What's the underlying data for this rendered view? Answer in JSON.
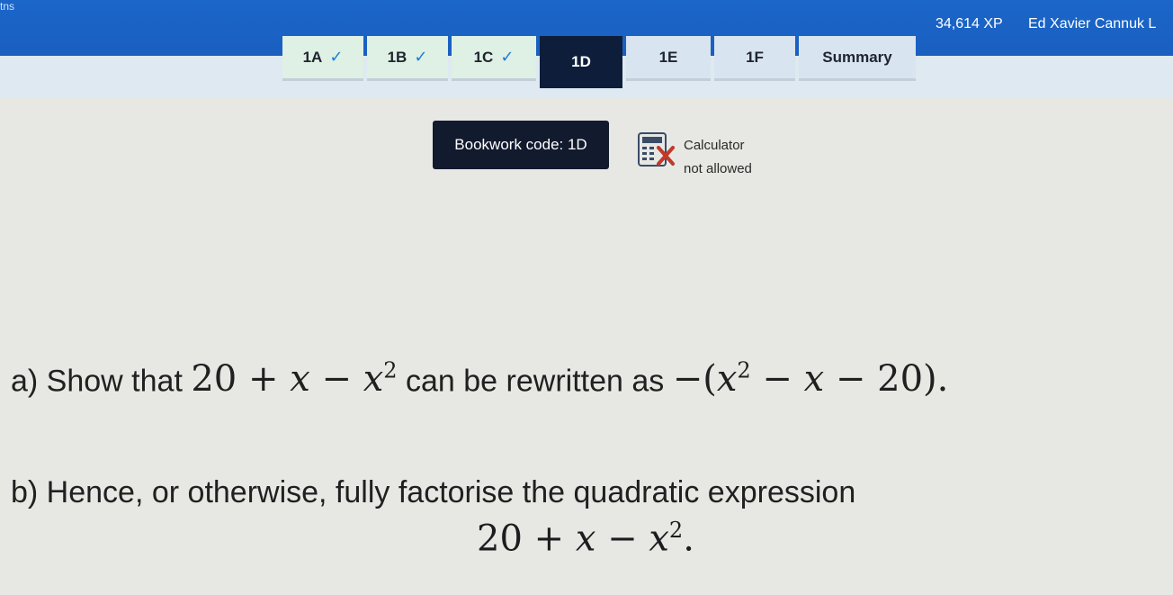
{
  "header": {
    "top_corner_text": "tns",
    "xp": "34,614 XP",
    "user_name": "Ed Xavier Cannuk L"
  },
  "tabs": [
    {
      "label": "1A",
      "state": "done"
    },
    {
      "label": "1B",
      "state": "done"
    },
    {
      "label": "1C",
      "state": "done"
    },
    {
      "label": "1D",
      "state": "active"
    },
    {
      "label": "1E",
      "state": "todo"
    },
    {
      "label": "1F",
      "state": "todo"
    },
    {
      "label": "Summary",
      "state": "todo"
    }
  ],
  "bookwork": {
    "label": "Bookwork code: 1D"
  },
  "calculator": {
    "line1": "Calculator",
    "line2": "not allowed",
    "icon": "calculator-crossed-icon"
  },
  "question": {
    "a_prefix": "a) Show that",
    "a_middle": "can be rewritten as",
    "b_text": "b) Hence, or otherwise, fully factorise the quadratic expression"
  },
  "colors": {
    "topbar": "#1a62c6",
    "active_tab": "#0e1e3a",
    "check": "#1a7ed8",
    "cross": "#c0392b"
  }
}
